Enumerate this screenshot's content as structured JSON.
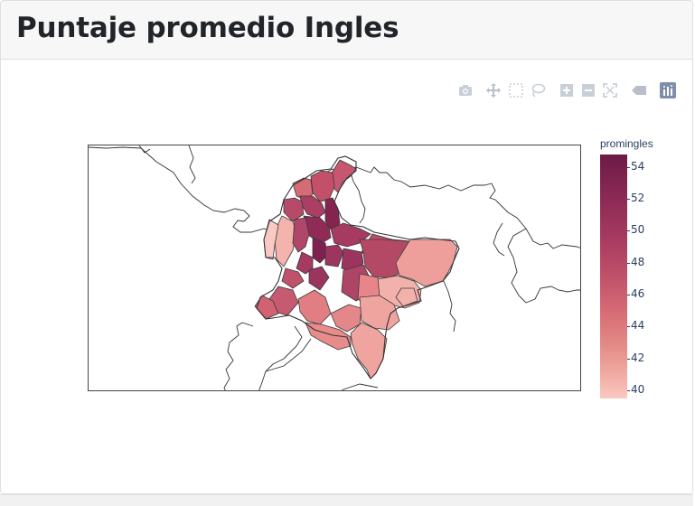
{
  "header": {
    "title": "Puntaje promedio Ingles"
  },
  "modebar": {
    "buttons": [
      {
        "icon": "camera-icon"
      },
      {
        "icon": "pan-icon"
      },
      {
        "icon": "box-select-icon"
      },
      {
        "icon": "lasso-select-icon"
      },
      {
        "icon": "zoom-in-icon"
      },
      {
        "icon": "zoom-out-icon"
      },
      {
        "icon": "reset-axes-icon"
      },
      {
        "icon": "hover-closest-icon"
      },
      {
        "icon": "plotly-logo-icon"
      }
    ]
  },
  "colorbar": {
    "title": "promingles",
    "ticks": [
      "54",
      "52",
      "50",
      "48",
      "46",
      "44",
      "42",
      "40"
    ],
    "colors": [
      "#6b1b45",
      "#8c2a55",
      "#a63a60",
      "#c0516a",
      "#d56b74",
      "#e48a86",
      "#f0aaa2",
      "#fbc9c3"
    ]
  },
  "chart_data": {
    "type": "choropleth",
    "color_variable": "promingles",
    "range": [
      39.5,
      55
    ],
    "scale": "pinkish sequential (light pink = low, dark magenta = high)"
  }
}
